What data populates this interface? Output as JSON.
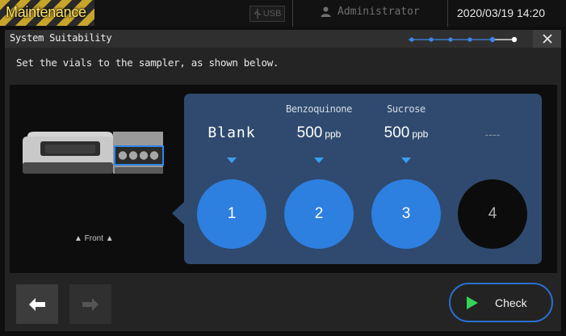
{
  "app": {
    "mode_badge": "Maintenance",
    "usb_label": "USB",
    "user": "Administrator",
    "datetime": "2020/03/19 14:20"
  },
  "window": {
    "title": "System Suitability",
    "progress": {
      "total_steps": 6,
      "current_step": 6
    },
    "instruction": "Set the vials to the sampler, as shown below."
  },
  "sampler": {
    "front_label": "▲ Front ▲"
  },
  "positions": [
    {
      "name": "",
      "value": "Blank",
      "unit": "",
      "slot": "1",
      "active": true
    },
    {
      "name": "Benzoquinone",
      "value": "500",
      "unit": "ppb",
      "slot": "2",
      "active": true
    },
    {
      "name": "Sucrose",
      "value": "500",
      "unit": "ppb",
      "slot": "3",
      "active": true
    },
    {
      "name": "",
      "value": "----",
      "unit": "",
      "slot": "4",
      "active": false
    }
  ],
  "buttons": {
    "check_label": "Check"
  },
  "icons": {
    "usb": "usb-icon",
    "user": "user-icon",
    "close": "close-icon",
    "back": "arrow-left-icon",
    "forward": "arrow-right-icon",
    "run": "play-icon"
  },
  "colors": {
    "accent_blue": "#2d7fe0",
    "card_bg": "#2f4a6e",
    "play_green": "#33d45a",
    "badge_yellow": "#ffe26b"
  }
}
